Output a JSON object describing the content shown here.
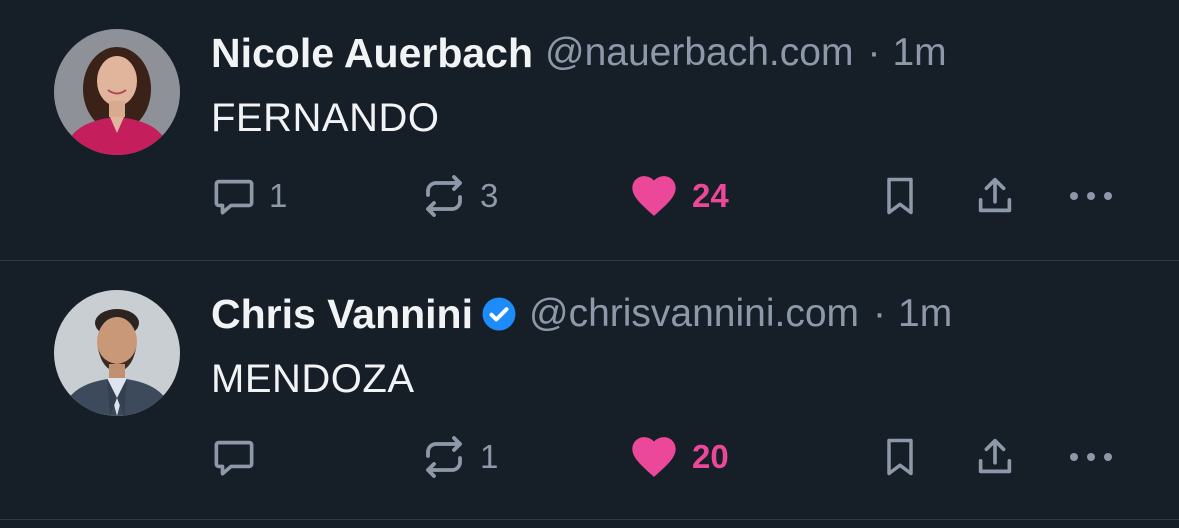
{
  "posts": [
    {
      "author_name": "Nicole Auerbach",
      "handle": "@nauerbach.com",
      "separator": "·",
      "time": "1m",
      "verified": false,
      "text": "FERNANDO",
      "avatar": "woman-portrait-avatar",
      "actions": {
        "reply_count": "1",
        "repost_count": "3",
        "like_count": "24",
        "liked": true
      }
    },
    {
      "author_name": "Chris Vannini",
      "handle": "@chrisvannini.com",
      "separator": "·",
      "time": "1m",
      "verified": true,
      "text": "MENDOZA",
      "avatar": "man-portrait-avatar",
      "actions": {
        "reply_count": "",
        "repost_count": "1",
        "like_count": "20",
        "liked": true
      }
    }
  ],
  "icons": {
    "reply": "reply-icon",
    "repost": "repost-icon",
    "like": "heart-icon",
    "bookmark": "bookmark-icon",
    "share": "share-icon",
    "more": "more-options-icon",
    "verified": "verified-badge-icon"
  },
  "colors": {
    "background": "#161e27",
    "muted_text": "#8d99a9",
    "like_pink": "#ec4899",
    "verified_blue": "#1d8cf8",
    "divider": "#2e3846"
  }
}
